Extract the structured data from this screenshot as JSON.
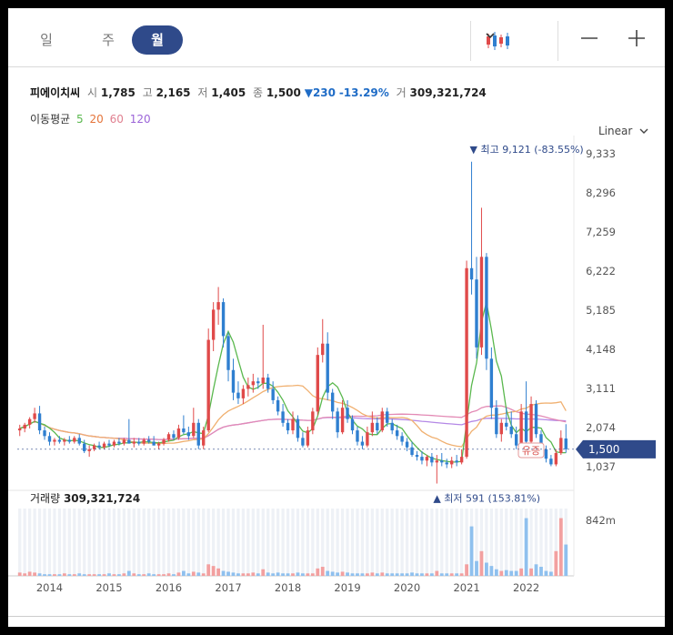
{
  "tabs": [
    {
      "label": "일",
      "active": false
    },
    {
      "label": "주",
      "active": false
    },
    {
      "label": "월",
      "active": true
    }
  ],
  "toolbar": {
    "chart_type_icon": "candlestick-icon",
    "dropdown_icon": "chevron-down-icon",
    "zoom_out_icon": "minus-icon",
    "zoom_in_icon": "plus-icon"
  },
  "stock": {
    "name": "피에이치씨",
    "open_label": "시",
    "open": "1,785",
    "high_label": "고",
    "high": "2,165",
    "low_label": "저",
    "low": "1,405",
    "close_label": "종",
    "close": "1,500",
    "change": "▼230",
    "change_pct": "-13.29%",
    "volume_label": "거",
    "volume": "309,321,724"
  },
  "ma": {
    "label": "이동평균",
    "periods": [
      {
        "value": "5",
        "color": "#5ab84e"
      },
      {
        "value": "20",
        "color": "#e5743a"
      },
      {
        "value": "60",
        "color": "#e08090"
      },
      {
        "value": "120",
        "color": "#9b64d8"
      }
    ]
  },
  "scale_toggle": "Linear",
  "colors": {
    "up": "#e04a4a",
    "down": "#2f7fd0",
    "ma5": "#5ab84e",
    "ma20": "#f0b070",
    "ma60": "#e38ab5",
    "ma120": "#b488e6",
    "badge": "#2f4a8a",
    "volume_up": "#f2a0a0",
    "volume_down": "#8fc0ee"
  },
  "chart_data": {
    "type": "candlestick",
    "title": "",
    "y_ticks": [
      "9,333",
      "8,296",
      "7,259",
      "6,222",
      "5,185",
      "4,148",
      "3,111",
      "2,074",
      "1,037"
    ],
    "ylim": [
      700,
      9333
    ],
    "x_ticks": [
      "2014",
      "2015",
      "2016",
      "2017",
      "2018",
      "2019",
      "2020",
      "2021",
      "2022"
    ],
    "current_price": "1,500",
    "high_annotation": "▼ 최고 9,121 (-83.55%)",
    "low_annotation": "▲ 최저 591 (153.81%)",
    "suspension_label": "유증",
    "volume_axis_tick": "842m",
    "volume_label": "거래량",
    "volume_value": "309,321,724",
    "candles": [
      {
        "o": 2000,
        "h": 2150,
        "l": 1850,
        "c": 2050
      },
      {
        "o": 2050,
        "h": 2200,
        "l": 1950,
        "c": 2150
      },
      {
        "o": 2150,
        "h": 2350,
        "l": 2050,
        "c": 2300
      },
      {
        "o": 2300,
        "h": 2600,
        "l": 2200,
        "c": 2450
      },
      {
        "o": 2450,
        "h": 2650,
        "l": 1900,
        "c": 2000
      },
      {
        "o": 2000,
        "h": 2100,
        "l": 1750,
        "c": 1850
      },
      {
        "o": 1850,
        "h": 1950,
        "l": 1600,
        "c": 1700
      },
      {
        "o": 1700,
        "h": 1800,
        "l": 1600,
        "c": 1750
      },
      {
        "o": 1750,
        "h": 1850,
        "l": 1650,
        "c": 1700
      },
      {
        "o": 1700,
        "h": 1800,
        "l": 1600,
        "c": 1750
      },
      {
        "o": 1750,
        "h": 1850,
        "l": 1650,
        "c": 1700
      },
      {
        "o": 1700,
        "h": 1850,
        "l": 1650,
        "c": 1800
      },
      {
        "o": 1800,
        "h": 1900,
        "l": 1600,
        "c": 1650
      },
      {
        "o": 1650,
        "h": 1750,
        "l": 1400,
        "c": 1450
      },
      {
        "o": 1450,
        "h": 1600,
        "l": 1300,
        "c": 1500
      },
      {
        "o": 1500,
        "h": 1650,
        "l": 1450,
        "c": 1600
      },
      {
        "o": 1600,
        "h": 1700,
        "l": 1500,
        "c": 1550
      },
      {
        "o": 1550,
        "h": 1700,
        "l": 1500,
        "c": 1650
      },
      {
        "o": 1650,
        "h": 1750,
        "l": 1550,
        "c": 1600
      },
      {
        "o": 1600,
        "h": 1750,
        "l": 1550,
        "c": 1700
      },
      {
        "o": 1700,
        "h": 1800,
        "l": 1600,
        "c": 1650
      },
      {
        "o": 1650,
        "h": 1800,
        "l": 1600,
        "c": 1750
      },
      {
        "o": 1750,
        "h": 2300,
        "l": 1650,
        "c": 1650
      },
      {
        "o": 1650,
        "h": 1800,
        "l": 1550,
        "c": 1700
      },
      {
        "o": 1700,
        "h": 1800,
        "l": 1600,
        "c": 1650
      },
      {
        "o": 1650,
        "h": 1800,
        "l": 1600,
        "c": 1750
      },
      {
        "o": 1750,
        "h": 1850,
        "l": 1650,
        "c": 1700
      },
      {
        "o": 1700,
        "h": 1850,
        "l": 1600,
        "c": 1600
      },
      {
        "o": 1600,
        "h": 1700,
        "l": 1500,
        "c": 1650
      },
      {
        "o": 1650,
        "h": 1800,
        "l": 1600,
        "c": 1750
      },
      {
        "o": 1750,
        "h": 1950,
        "l": 1700,
        "c": 1900
      },
      {
        "o": 1900,
        "h": 2000,
        "l": 1750,
        "c": 1800
      },
      {
        "o": 1800,
        "h": 2150,
        "l": 1750,
        "c": 2050
      },
      {
        "o": 2050,
        "h": 2400,
        "l": 1900,
        "c": 1950
      },
      {
        "o": 1950,
        "h": 2100,
        "l": 1750,
        "c": 1850
      },
      {
        "o": 1850,
        "h": 2600,
        "l": 1800,
        "c": 2200
      },
      {
        "o": 2200,
        "h": 2300,
        "l": 1500,
        "c": 1600
      },
      {
        "o": 1600,
        "h": 2100,
        "l": 1500,
        "c": 2000
      },
      {
        "o": 2000,
        "h": 4700,
        "l": 1950,
        "c": 4400
      },
      {
        "o": 4400,
        "h": 5400,
        "l": 4100,
        "c": 5200
      },
      {
        "o": 5200,
        "h": 5800,
        "l": 4800,
        "c": 5400
      },
      {
        "o": 5400,
        "h": 5500,
        "l": 4200,
        "c": 4500
      },
      {
        "o": 4500,
        "h": 4600,
        "l": 3300,
        "c": 3600
      },
      {
        "o": 3600,
        "h": 3900,
        "l": 2800,
        "c": 3000
      },
      {
        "o": 3000,
        "h": 3300,
        "l": 2700,
        "c": 2850
      },
      {
        "o": 2850,
        "h": 3200,
        "l": 2700,
        "c": 3100
      },
      {
        "o": 3100,
        "h": 3400,
        "l": 2900,
        "c": 3200
      },
      {
        "o": 3200,
        "h": 3500,
        "l": 3000,
        "c": 3300
      },
      {
        "o": 3300,
        "h": 3400,
        "l": 3100,
        "c": 3250
      },
      {
        "o": 3250,
        "h": 4800,
        "l": 3100,
        "c": 3400
      },
      {
        "o": 3400,
        "h": 3500,
        "l": 3000,
        "c": 3100
      },
      {
        "o": 3100,
        "h": 3300,
        "l": 2700,
        "c": 2800
      },
      {
        "o": 2800,
        "h": 2900,
        "l": 2400,
        "c": 2500
      },
      {
        "o": 2500,
        "h": 2700,
        "l": 2100,
        "c": 2200
      },
      {
        "o": 2200,
        "h": 2300,
        "l": 1900,
        "c": 2000
      },
      {
        "o": 2000,
        "h": 2500,
        "l": 1900,
        "c": 2300
      },
      {
        "o": 2300,
        "h": 2400,
        "l": 1700,
        "c": 1800
      },
      {
        "o": 1800,
        "h": 1950,
        "l": 1550,
        "c": 1600
      },
      {
        "o": 1600,
        "h": 2100,
        "l": 1550,
        "c": 2000
      },
      {
        "o": 2000,
        "h": 2600,
        "l": 1900,
        "c": 2500
      },
      {
        "o": 2500,
        "h": 4200,
        "l": 2400,
        "c": 4000
      },
      {
        "o": 4000,
        "h": 4950,
        "l": 3800,
        "c": 4300
      },
      {
        "o": 4300,
        "h": 4600,
        "l": 2800,
        "c": 3000
      },
      {
        "o": 3000,
        "h": 3100,
        "l": 2300,
        "c": 2500
      },
      {
        "o": 2500,
        "h": 2600,
        "l": 1800,
        "c": 1950
      },
      {
        "o": 1950,
        "h": 2800,
        "l": 1900,
        "c": 2600
      },
      {
        "o": 2600,
        "h": 2800,
        "l": 2200,
        "c": 2300
      },
      {
        "o": 2300,
        "h": 2400,
        "l": 1900,
        "c": 2000
      },
      {
        "o": 2000,
        "h": 2100,
        "l": 1600,
        "c": 1700
      },
      {
        "o": 1700,
        "h": 1850,
        "l": 1500,
        "c": 1600
      },
      {
        "o": 1600,
        "h": 2100,
        "l": 1550,
        "c": 1950
      },
      {
        "o": 1950,
        "h": 2500,
        "l": 1850,
        "c": 2200
      },
      {
        "o": 2200,
        "h": 2350,
        "l": 1900,
        "c": 2000
      },
      {
        "o": 2000,
        "h": 2600,
        "l": 1950,
        "c": 2500
      },
      {
        "o": 2500,
        "h": 2600,
        "l": 2100,
        "c": 2200
      },
      {
        "o": 2200,
        "h": 2300,
        "l": 1900,
        "c": 2000
      },
      {
        "o": 2000,
        "h": 2150,
        "l": 1750,
        "c": 1850
      },
      {
        "o": 1850,
        "h": 1950,
        "l": 1600,
        "c": 1700
      },
      {
        "o": 1700,
        "h": 1800,
        "l": 1450,
        "c": 1550
      },
      {
        "o": 1550,
        "h": 1700,
        "l": 1300,
        "c": 1350
      },
      {
        "o": 1350,
        "h": 1450,
        "l": 1200,
        "c": 1300
      },
      {
        "o": 1300,
        "h": 1450,
        "l": 1100,
        "c": 1200
      },
      {
        "o": 1200,
        "h": 1350,
        "l": 1050,
        "c": 1300
      },
      {
        "o": 1300,
        "h": 1400,
        "l": 1050,
        "c": 1150
      },
      {
        "o": 1150,
        "h": 1350,
        "l": 591,
        "c": 1200
      },
      {
        "o": 1200,
        "h": 1400,
        "l": 1050,
        "c": 1150
      },
      {
        "o": 1150,
        "h": 1250,
        "l": 1000,
        "c": 1100
      },
      {
        "o": 1100,
        "h": 1300,
        "l": 1000,
        "c": 1200
      },
      {
        "o": 1200,
        "h": 1350,
        "l": 1050,
        "c": 1150
      },
      {
        "o": 1150,
        "h": 1500,
        "l": 1100,
        "c": 1300
      },
      {
        "o": 1300,
        "h": 6500,
        "l": 1250,
        "c": 6300
      },
      {
        "o": 6300,
        "h": 9121,
        "l": 5600,
        "c": 6000
      },
      {
        "o": 6000,
        "h": 6600,
        "l": 3900,
        "c": 4200
      },
      {
        "o": 4200,
        "h": 7900,
        "l": 4000,
        "c": 6600
      },
      {
        "o": 6600,
        "h": 6700,
        "l": 3600,
        "c": 3900
      },
      {
        "o": 3900,
        "h": 4200,
        "l": 2300,
        "c": 2600
      },
      {
        "o": 2600,
        "h": 2800,
        "l": 1800,
        "c": 1900
      },
      {
        "o": 1900,
        "h": 2300,
        "l": 1700,
        "c": 2200
      },
      {
        "o": 2200,
        "h": 2600,
        "l": 2000,
        "c": 2100
      },
      {
        "o": 2100,
        "h": 2500,
        "l": 1800,
        "c": 1900
      },
      {
        "o": 1900,
        "h": 2100,
        "l": 1500,
        "c": 1600
      },
      {
        "o": 1600,
        "h": 2700,
        "l": 1550,
        "c": 2500
      },
      {
        "o": 2500,
        "h": 3300,
        "l": 1500,
        "c": 1700
      },
      {
        "o": 1700,
        "h": 2900,
        "l": 1650,
        "c": 2700
      },
      {
        "o": 2700,
        "h": 2800,
        "l": 1800,
        "c": 1900
      },
      {
        "o": 1900,
        "h": 2000,
        "l": 1400,
        "c": 1500
      },
      {
        "o": 1500,
        "h": 1600,
        "l": 1150,
        "c": 1250
      },
      {
        "o": 1250,
        "h": 1350,
        "l": 1050,
        "c": 1100
      },
      {
        "o": 1100,
        "h": 1500,
        "l": 1050,
        "c": 1400
      },
      {
        "o": 1400,
        "h": 2000,
        "l": 1350,
        "c": 1800
      },
      {
        "o": 1785,
        "h": 2165,
        "l": 1405,
        "c": 1500
      }
    ],
    "volume": [
      4,
      3,
      5,
      4,
      3,
      2,
      2,
      2,
      2,
      3,
      2,
      2,
      3,
      2,
      2,
      2,
      2,
      2,
      3,
      2,
      2,
      3,
      6,
      3,
      2,
      2,
      3,
      2,
      2,
      2,
      3,
      2,
      4,
      6,
      3,
      5,
      4,
      3,
      14,
      12,
      9,
      6,
      5,
      4,
      3,
      3,
      3,
      4,
      3,
      8,
      4,
      3,
      4,
      3,
      3,
      3,
      4,
      3,
      3,
      3,
      9,
      11,
      6,
      5,
      4,
      5,
      4,
      3,
      3,
      3,
      3,
      4,
      3,
      4,
      3,
      3,
      3,
      3,
      3,
      4,
      3,
      3,
      3,
      3,
      6,
      3,
      3,
      3,
      3,
      3,
      14,
      60,
      18,
      30,
      16,
      12,
      8,
      6,
      7,
      6,
      6,
      9,
      70,
      9,
      14,
      11,
      6,
      5,
      30,
      70,
      38
    ]
  }
}
